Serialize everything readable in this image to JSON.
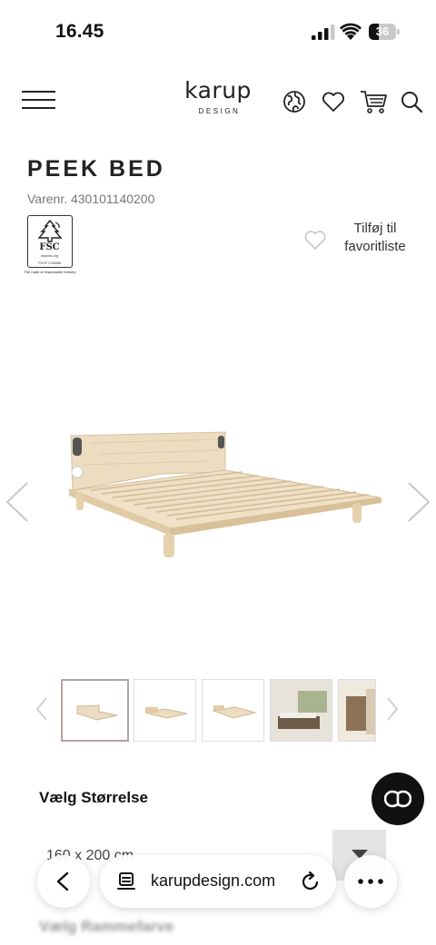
{
  "status_bar": {
    "time": "16.45",
    "battery_level": "36",
    "battery_fraction": 0.36
  },
  "header": {
    "logo": "karup",
    "logo_sub": "DESIGN",
    "icons": [
      "menu-icon",
      "globe-icon",
      "heart-icon",
      "cart-icon",
      "search-icon"
    ]
  },
  "product": {
    "title": "PEEK BED",
    "sku": "Varenr. 430101140200",
    "fsc": {
      "label": "FSC",
      "url": "www.fsc.org",
      "code": "FSC® C108386",
      "caption": "The mark of responsible forestry"
    },
    "favorite_line1": "Tilføj til",
    "favorite_line2": "favoritliste"
  },
  "gallery": {
    "thumbnail_count": 5,
    "active_index": 0
  },
  "options": {
    "size_label": "Vælg Størrelse",
    "size_value": "160 x 200 cm",
    "color_label": "Vælg Rammefarve"
  },
  "browser": {
    "url": "karupdesign.com"
  },
  "colors": {
    "accent_thumb_border": "#b7a3a3",
    "chat_button": "#111111",
    "wood": "#e8d3b0"
  }
}
